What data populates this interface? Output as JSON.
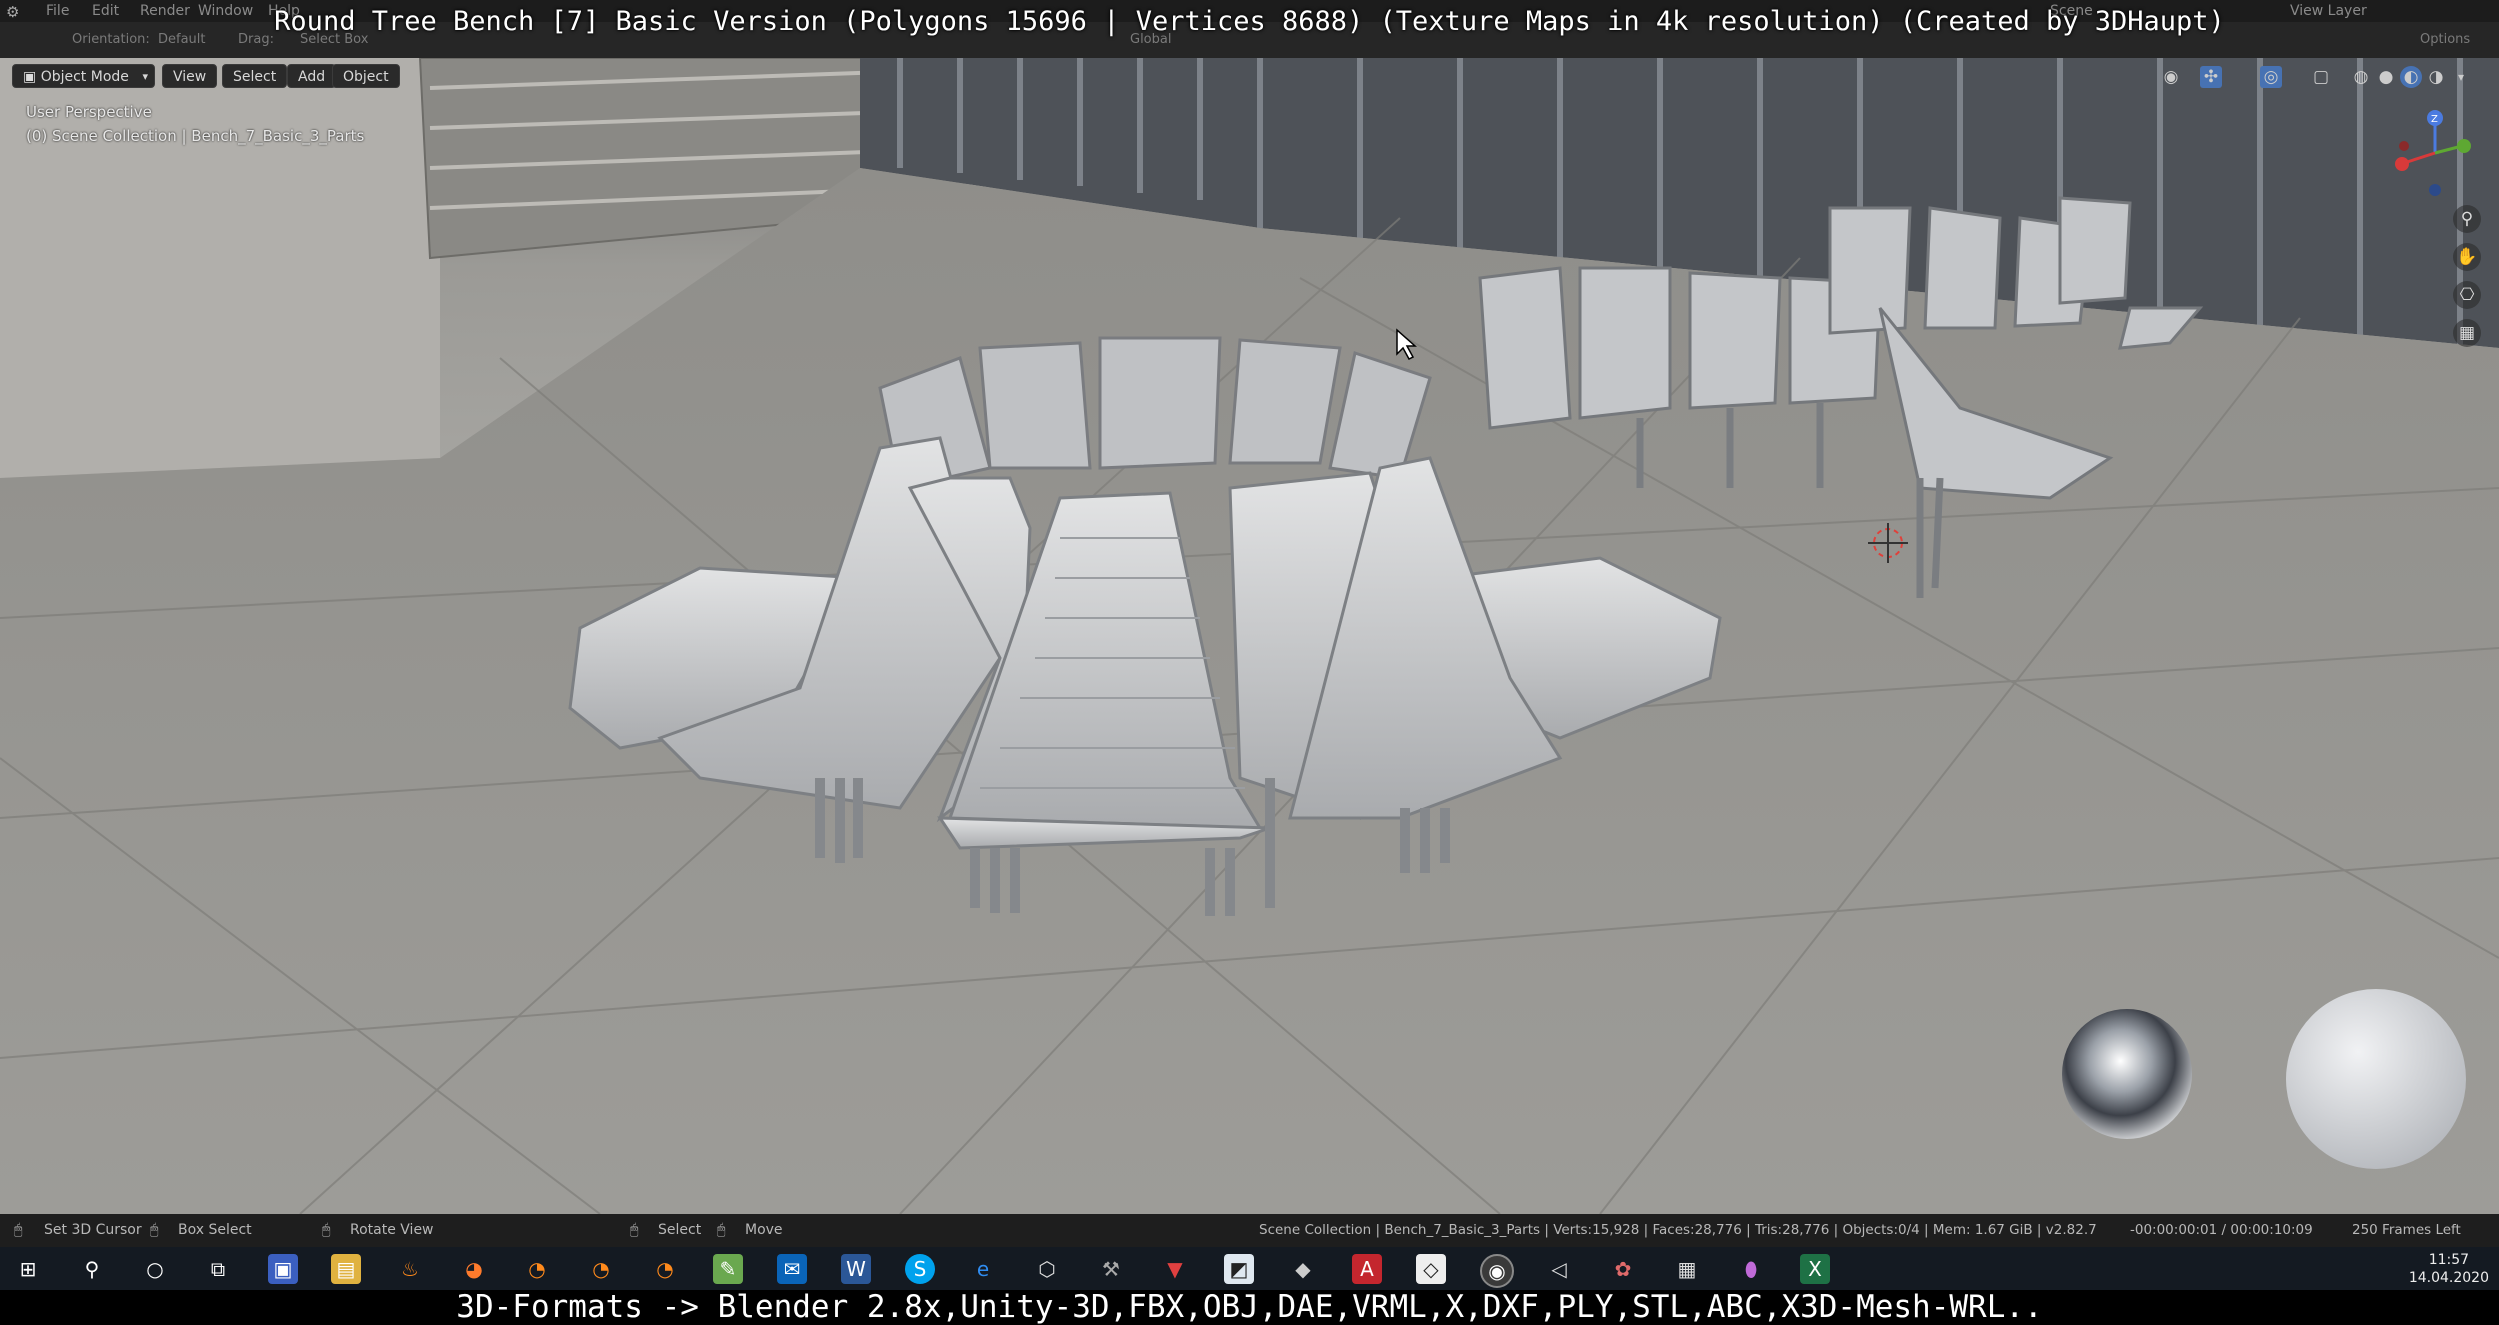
{
  "video_title": "Round Tree Bench [7] Basic Version (Polygons 15696 | Vertices 8688) (Texture Maps in 4k resolution) (Created by 3DHaupt)",
  "menu": {
    "items": [
      "File",
      "Edit",
      "Render",
      "Window",
      "Help"
    ],
    "scene_label": "Scene",
    "view_layer_label": "View Layer"
  },
  "tool_header": {
    "orientation_label": "Orientation:",
    "orientation_value": "Default",
    "drag_label": "Drag:",
    "drag_value": "Select Box",
    "transform_value": "Global",
    "options_label": "Options"
  },
  "viewport_header": {
    "mode": "Object Mode",
    "menus": [
      "View",
      "Select",
      "Add",
      "Object"
    ]
  },
  "view_info": {
    "perspective": "User Perspective",
    "collection": "(0) Scene Collection | Bench_7_Basic_3_Parts"
  },
  "gizmo": {
    "z": "Z",
    "x": "X",
    "y": "Y"
  },
  "status": {
    "set_cursor": "Set 3D Cursor",
    "box_select": "Box Select",
    "rotate_view": "Rotate View",
    "select": "Select",
    "move": "Move",
    "stats": "Scene Collection | Bench_7_Basic_3_Parts | Verts:15,928 | Faces:28,776 | Tris:28,776 | Objects:0/4 | Mem: 1.67 GiB | v2.82.7",
    "timecode": "-00:00:00:01 / 00:00:10:09",
    "frames_left": "250 Frames Left"
  },
  "taskbar": {
    "time": "11:57",
    "date": "14.04.2020"
  },
  "formats_banner": "3D-Formats -> Blender 2.8x,Unity-3D,FBX,OBJ,DAE,VRML,X,DXF,PLY,STL,ABC,X3D-Mesh-WRL..",
  "colors": {
    "blender_bg": "#262626",
    "accent": "#4772b3",
    "taskbar": "#141a22"
  }
}
